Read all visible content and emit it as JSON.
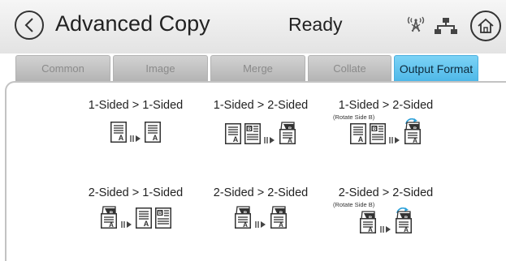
{
  "header": {
    "back_icon": "chevron-left-icon",
    "title": "Advanced Copy",
    "status": "Ready",
    "wireless_icon": "wireless-signal-icon",
    "network_icon": "network-icon",
    "home_icon": "home-icon"
  },
  "tabs": [
    {
      "label": "Common",
      "active": false
    },
    {
      "label": "Image",
      "active": false
    },
    {
      "label": "Merge",
      "active": false
    },
    {
      "label": "Collate",
      "active": false
    },
    {
      "label": "Output Format",
      "active": true
    }
  ],
  "options": [
    {
      "label": "1-Sided > 1-Sided",
      "sublabel": ""
    },
    {
      "label": "1-Sided > 2-Sided",
      "sublabel": ""
    },
    {
      "label": "1-Sided > 2-Sided",
      "sublabel": "(Rotate Side B)"
    },
    {
      "label": "2-Sided > 1-Sided",
      "sublabel": ""
    },
    {
      "label": "2-Sided > 2-Sided",
      "sublabel": ""
    },
    {
      "label": "2-Sided > 2-Sided",
      "sublabel": "(Rotate Side B)"
    }
  ],
  "page_glyphs": {
    "side_a": "A",
    "side_b": "B"
  },
  "colors": {
    "active_tab": "#4fb8e8",
    "rotate_accent": "#2a9fd8"
  }
}
